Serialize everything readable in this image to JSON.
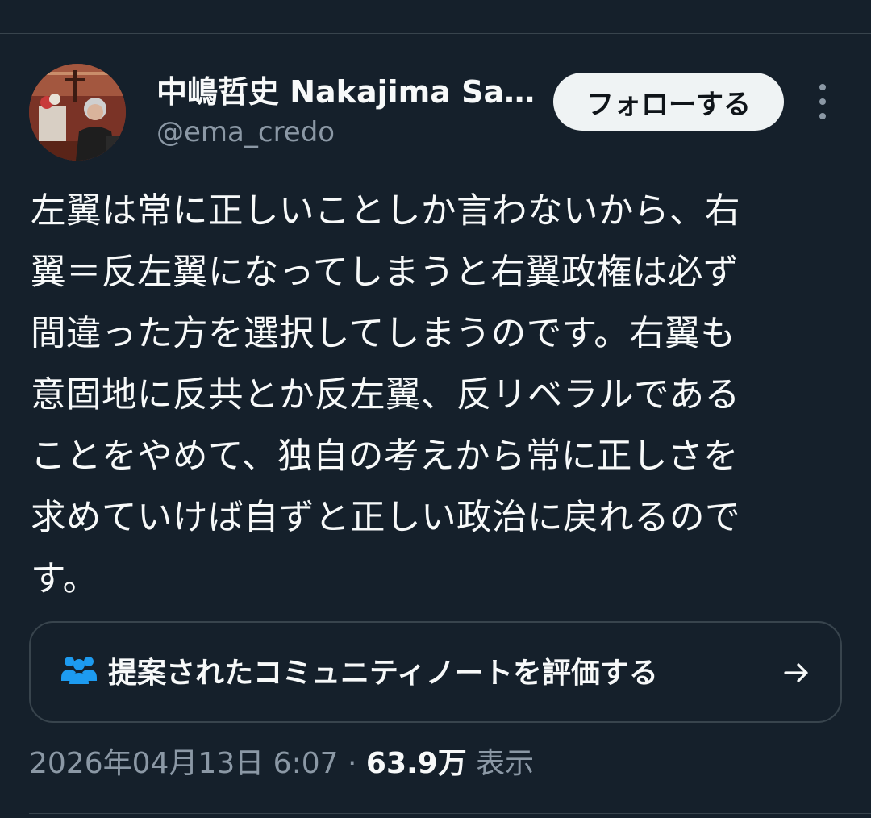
{
  "author": {
    "display_name": "中嶋哲史 Nakajima Sat...",
    "handle": "@ema_credo",
    "avatar_icon": "profile-photo"
  },
  "follow_button": {
    "label": "フォローする"
  },
  "more_menu": {
    "icon": "more-vertical-icon"
  },
  "tweet": {
    "lines": [
      "左翼は常に正しいことしか言わないから、右",
      "翼＝反左翼になってしまうと右翼政権は必ず",
      "間違った方を選択してしまうのです。右翼も",
      "意固地に反共とか反左翼、反リベラルである",
      "ことをやめて、独自の考えから常に正しさを",
      "求めていけば自ずと正しい政治に戻れるので",
      "す。"
    ]
  },
  "community_note": {
    "label": "提案されたコミュニティノートを評価する",
    "icon": "people-icon",
    "accent_color": "#1d9bf0",
    "arrow_icon": "arrow-right-icon"
  },
  "meta": {
    "timestamp": "2026年04月13日 6:07",
    "separator": "·",
    "views_count": "63.9万",
    "views_label": "表示"
  },
  "colors": {
    "background": "#15202b",
    "text_primary": "#f7f9f9",
    "text_secondary": "#8b98a5",
    "border": "#38444d"
  }
}
